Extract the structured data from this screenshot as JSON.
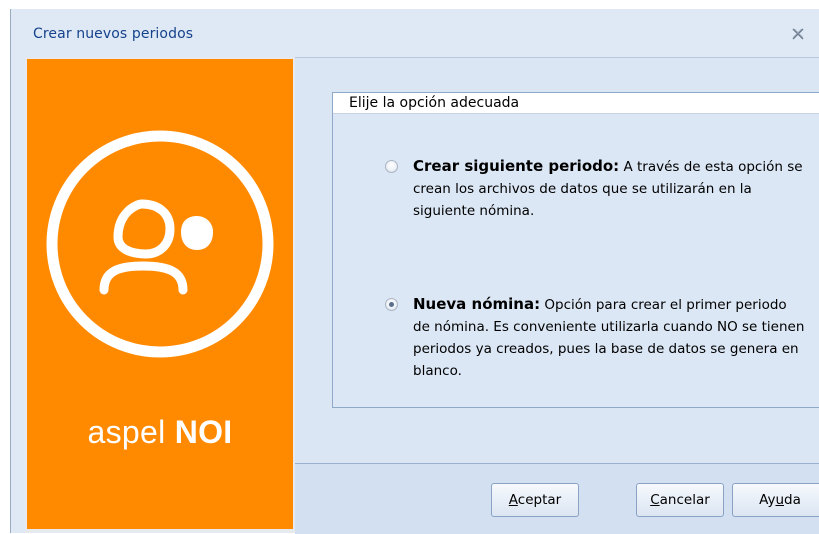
{
  "window": {
    "title": "Crear nuevos periodos",
    "close_icon": "close-icon"
  },
  "branding": {
    "logo_icon": "user-group-icon",
    "brand_prefix": "aspel",
    "brand_product": "NOI",
    "accent_color": "#ff8a00"
  },
  "group": {
    "title": "Elije la opción adecuada",
    "options": [
      {
        "title": "Crear siguiente periodo:",
        "description": " A través de esta opción se crean los archivos de datos que se utilizarán en la siguiente nómina.",
        "selected": false
      },
      {
        "title": "Nueva nómina:",
        "description": " Opción para crear el primer periodo de nómina. Es conveniente utilizarla cuando NO se tienen periodos ya creados, pues la base de datos se genera en blanco.",
        "selected": true
      }
    ]
  },
  "buttons": {
    "accept_first": "A",
    "accept_rest": "ceptar",
    "cancel_first": "C",
    "cancel_rest": "ancelar",
    "help_first": "Ay",
    "help_mid": "u",
    "help_rest": "da"
  }
}
